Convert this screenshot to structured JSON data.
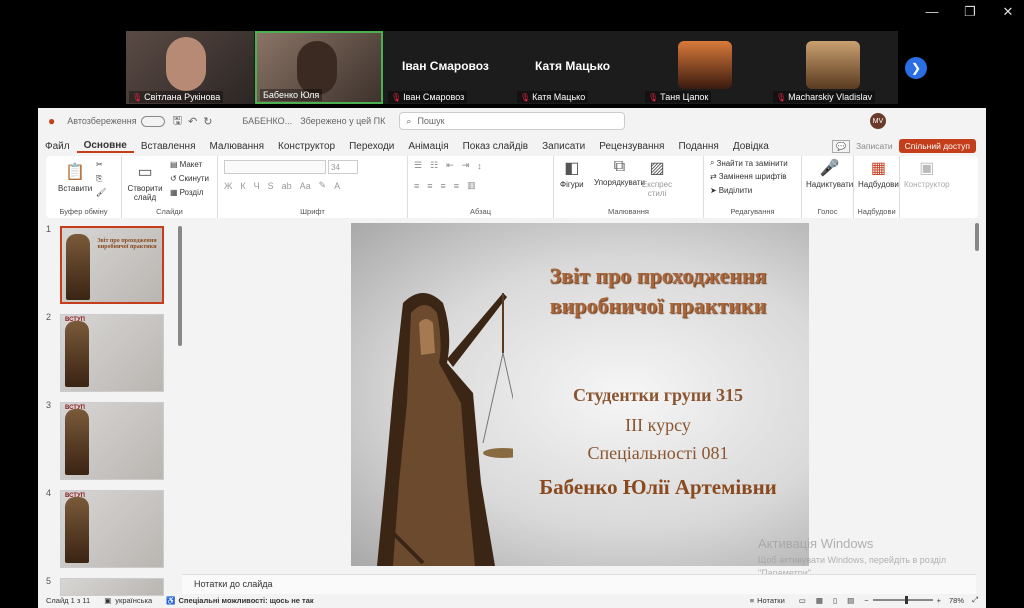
{
  "participants": [
    {
      "name": "Світлана Рукінова"
    },
    {
      "name": "Бабенко Юля"
    },
    {
      "name": "Іван Смаровоз"
    },
    {
      "name": "Катя Мацько"
    },
    {
      "name": "Таня Цапок"
    },
    {
      "name": "Macharskiy Vladislav"
    }
  ],
  "big_names": [
    "Іван Смаровоз",
    "Катя Мацько"
  ],
  "titlebar": {
    "autosave": "Автозбереження",
    "filename": "БАБЕНКО...",
    "saved": "Збережено у цей ПК",
    "search": "Пошук",
    "avatar": "MV"
  },
  "ribbon_tabs": [
    "Файл",
    "Основне",
    "Вставлення",
    "Малювання",
    "Конструктор",
    "Переходи",
    "Анімація",
    "Показ слайдів",
    "Записати",
    "Рецензування",
    "Подання",
    "Довідка"
  ],
  "ribbon_right": {
    "record": "Записати",
    "share": "Спільний доступ"
  },
  "ribbon": {
    "paste": "Вставити",
    "clipboard": "Буфер обміну",
    "new_slide": "Створити слайд",
    "layout": "Макет",
    "reset": "Скинути",
    "section": "Розділ",
    "slides": "Слайди",
    "font_size": "34",
    "font": "Шрифт",
    "paragraph": "Абзац",
    "shapes": "Фігури",
    "arrange": "Упорядкувати",
    "quick_styles": "Експрес стилі",
    "drawing": "Малювання",
    "find_replace": "Знайти та замінити",
    "replace_fonts": "Заміненя шрифтів",
    "select": "Виділити",
    "editing": "Редагування",
    "dictate": "Надиктувати",
    "voice": "Голос",
    "addins": "Надбудови",
    "addins_grp": "Надбудови",
    "designer": "Конструктор"
  },
  "thumbs": [
    {
      "num": "1",
      "title": "Звіт про проходження виробничої практики"
    },
    {
      "num": "2",
      "title": "ВСТУП"
    },
    {
      "num": "3",
      "title": "ВСТУП"
    },
    {
      "num": "4",
      "title": "ВСТУП"
    },
    {
      "num": "5",
      "title": ""
    }
  ],
  "slide": {
    "title_line1": "Звіт про проходження",
    "title_line2": "виробничої практики",
    "line1": "Студентки групи 315",
    "line2": "III курсу",
    "line3": "Спеціальності 081",
    "line4": "Бабенко Юлії Артемівни"
  },
  "notes": "Нотатки до слайда",
  "watermark": {
    "line1": "Активація Windows",
    "line2": "Щоб активувати Windows, перейдіть в розділ",
    "line3": "\"Параметри\"."
  },
  "status": {
    "slide": "Слайд 1 з 11",
    "lang": "українська",
    "accessibility": "Спеціальні можливості: щось не так",
    "notes": "Нотатки",
    "zoom": "78%"
  }
}
